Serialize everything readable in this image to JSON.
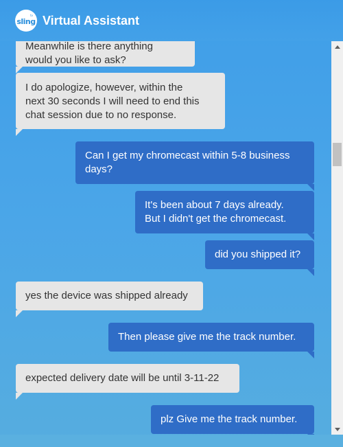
{
  "header": {
    "logo_text": "sling",
    "logo_small": "tv",
    "title": "Virtual Assistant"
  },
  "messages": [
    {
      "sender": "bot",
      "lines": [
        "Meanwhile is there anything",
        "would you like to ask?"
      ]
    },
    {
      "sender": "bot",
      "lines": [
        "I do apologize, however, within the",
        "next 30 seconds I will need to end this",
        "chat session due to no response."
      ]
    },
    {
      "sender": "user",
      "lines": [
        "Can I get my chromecast within 5-8 business",
        "days?"
      ]
    },
    {
      "sender": "user",
      "lines": [
        "It's been about 7 days already.",
        "But I didn't get the chromecast."
      ]
    },
    {
      "sender": "user",
      "lines": [
        "did you shipped it?"
      ]
    },
    {
      "sender": "bot",
      "lines": [
        "yes the device was shipped already"
      ]
    },
    {
      "sender": "user",
      "lines": [
        "Then please give me the track number."
      ]
    },
    {
      "sender": "bot",
      "lines": [
        "expected delivery date will be until 3-11-22"
      ]
    },
    {
      "sender": "user",
      "lines": [
        "plz Give me the track number."
      ]
    }
  ],
  "colors": {
    "background": "#4ba6e8",
    "bot_bubble": "#e6e6e6",
    "user_bubble": "#2f6dc7"
  }
}
